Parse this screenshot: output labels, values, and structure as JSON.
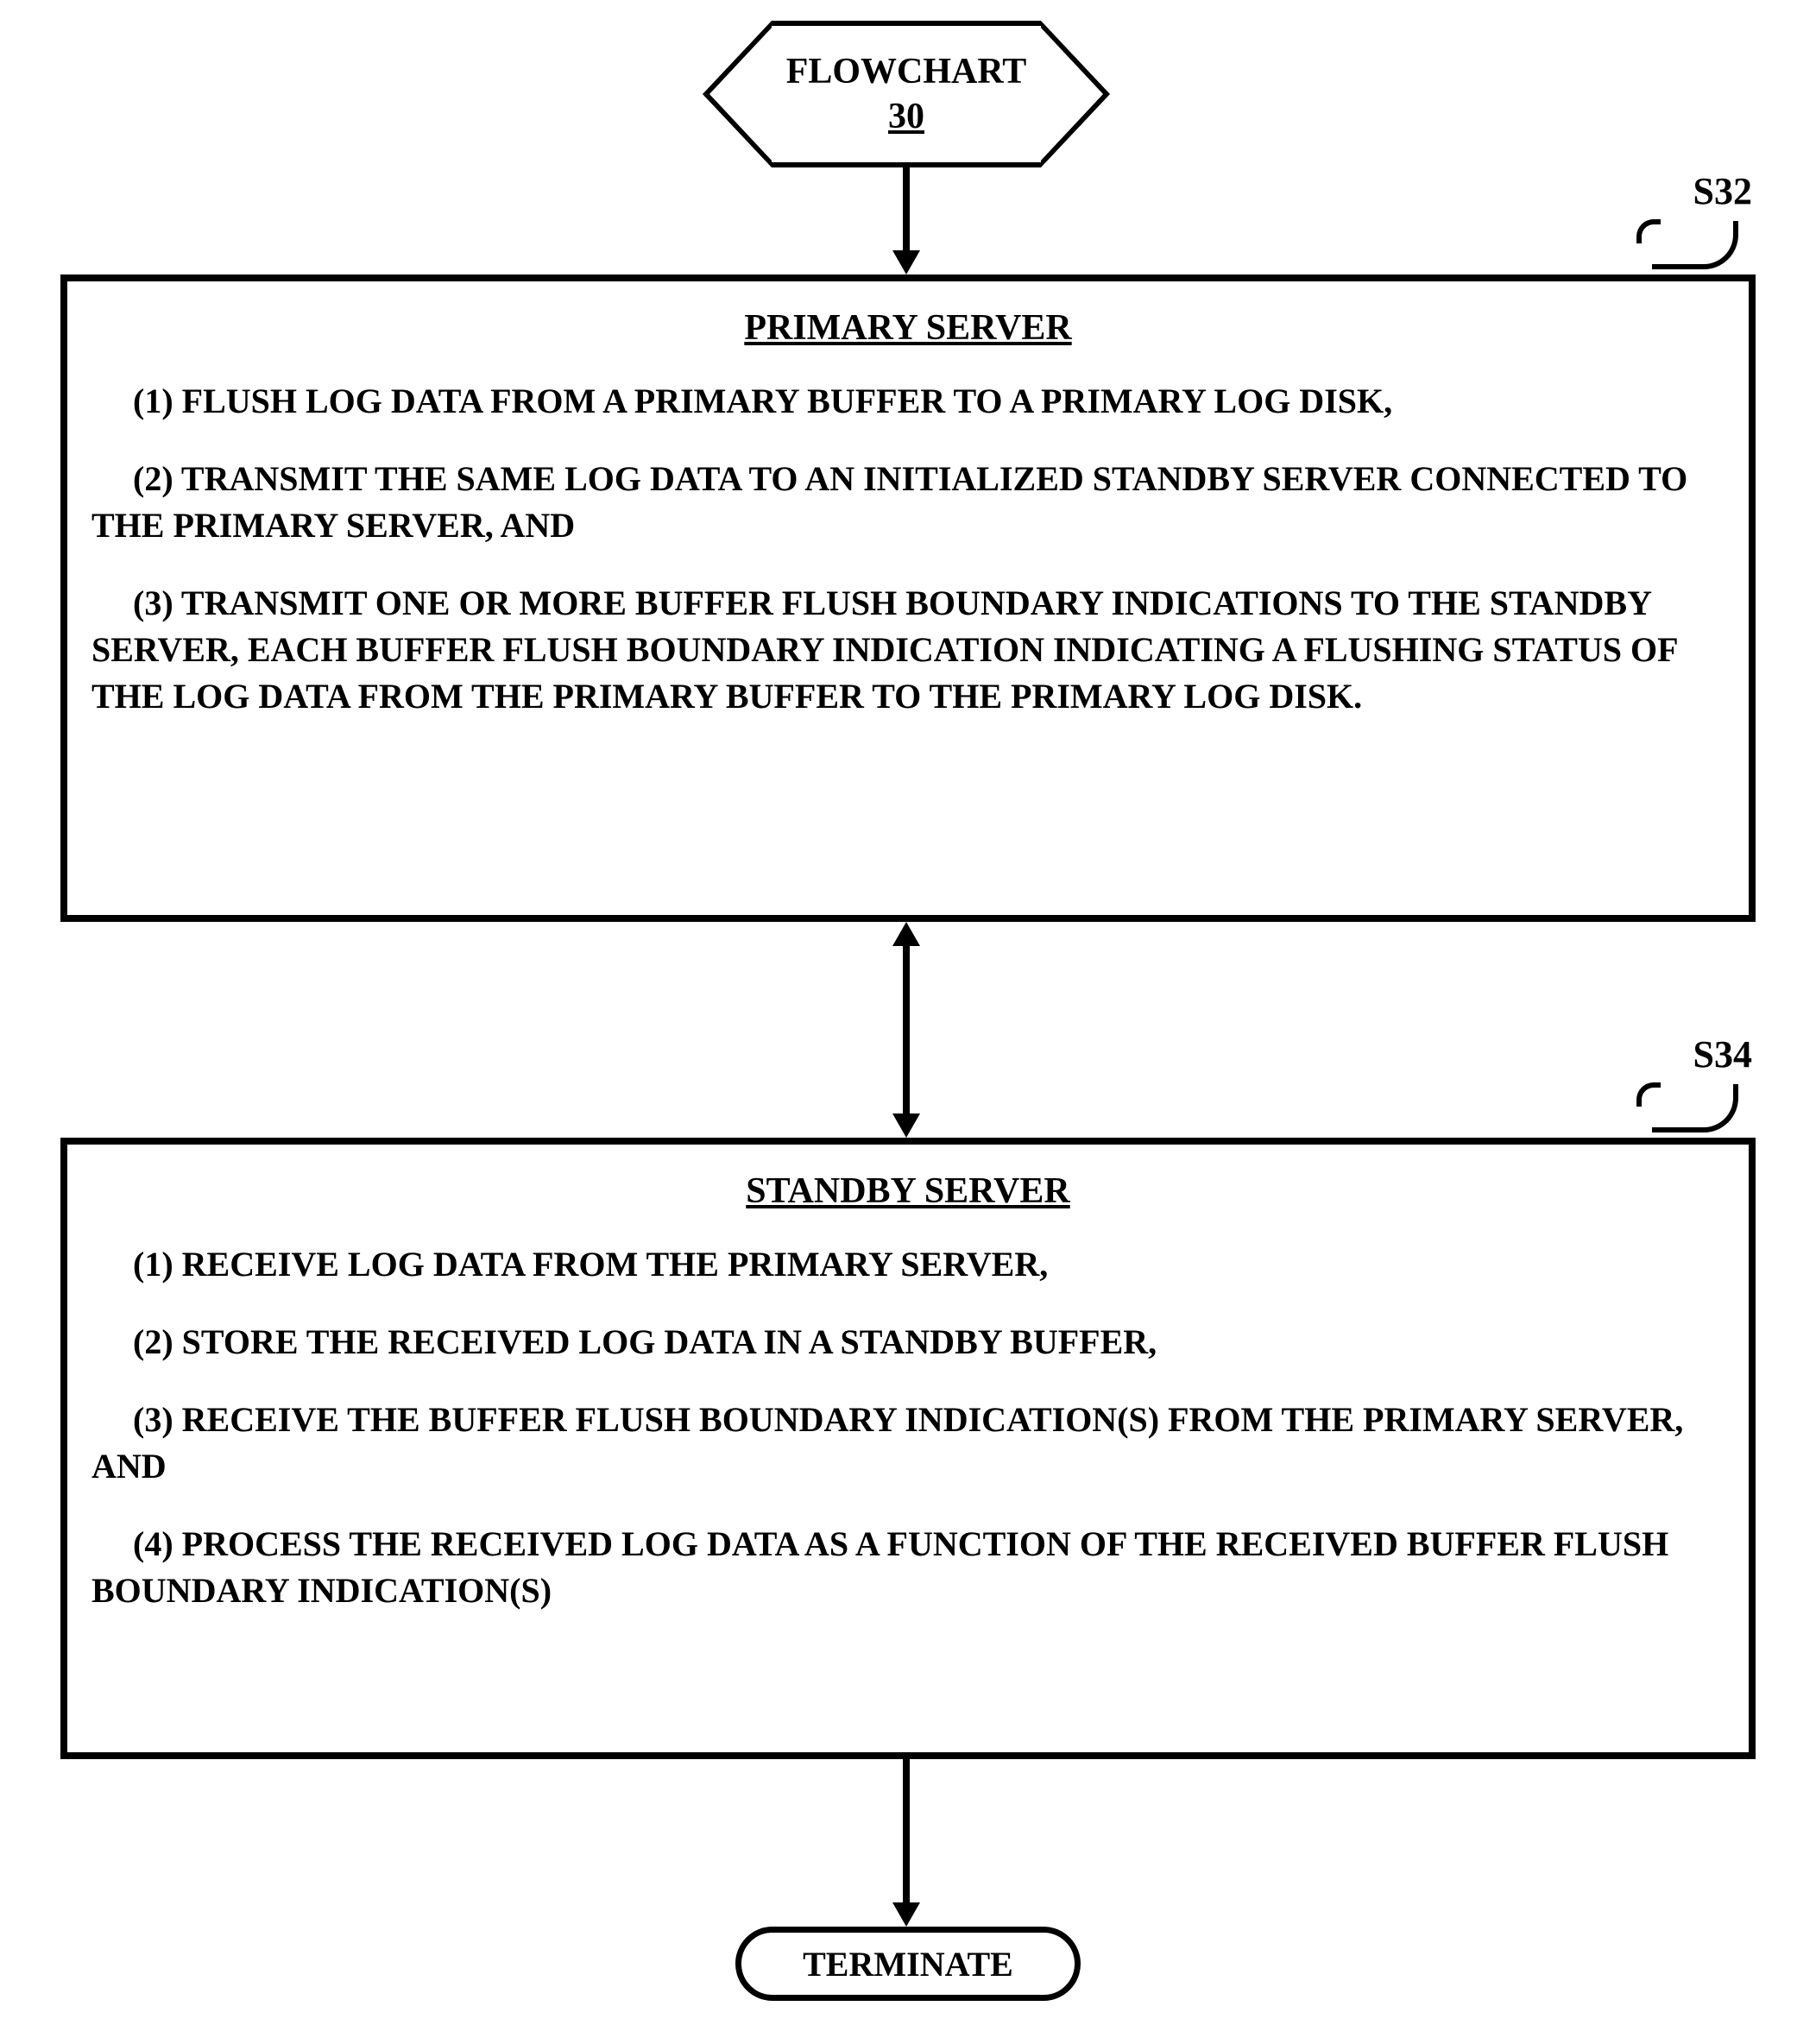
{
  "flowchart_label": "FLOWCHART",
  "flowchart_number": "30",
  "step_refs": {
    "s32": "S32",
    "s34": "S34"
  },
  "box_primary": {
    "title": "PRIMARY SERVER",
    "steps": [
      "(1)  FLUSH LOG DATA FROM A PRIMARY BUFFER TO A PRIMARY LOG DISK,",
      "(2)  TRANSMIT THE SAME LOG DATA TO AN INITIALIZED STANDBY SERVER CONNECTED TO THE PRIMARY SERVER, AND",
      "(3)  TRANSMIT ONE OR MORE BUFFER FLUSH BOUNDARY INDICATIONS TO THE STANDBY SERVER, EACH BUFFER FLUSH BOUNDARY INDICATION INDICATING A FLUSHING STATUS OF THE LOG DATA FROM THE PRIMARY BUFFER TO THE PRIMARY LOG DISK."
    ]
  },
  "box_standby": {
    "title": "STANDBY SERVER",
    "steps": [
      "(1)  RECEIVE LOG DATA FROM THE PRIMARY SERVER,",
      "(2)  STORE THE RECEIVED LOG DATA IN A STANDBY BUFFER,",
      "(3)  RECEIVE THE BUFFER FLUSH BOUNDARY INDICATION(S) FROM THE PRIMARY SERVER, AND",
      "(4)  PROCESS THE RECEIVED LOG DATA AS A FUNCTION OF THE RECEIVED BUFFER FLUSH BOUNDARY INDICATION(S)"
    ]
  },
  "terminate_label": "TERMINATE"
}
